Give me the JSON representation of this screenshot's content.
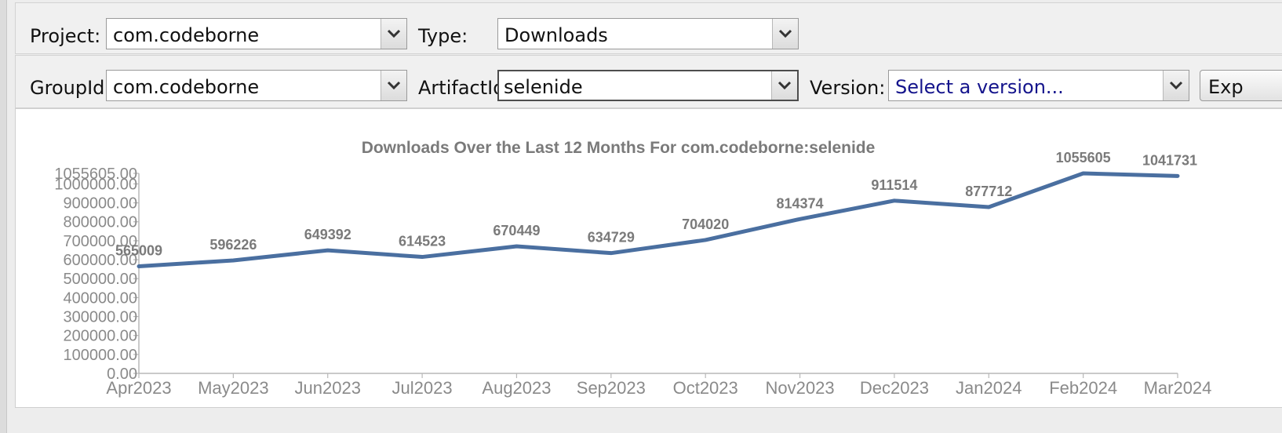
{
  "row1": {
    "project_label": "Project:",
    "project_value": "com.codeborne",
    "type_label": "Type:",
    "type_value": "Downloads"
  },
  "row2": {
    "groupid_label": "GroupId:",
    "groupid_value": "com.codeborne",
    "artifactid_label": "ArtifactId:",
    "artifactid_value": "selenide",
    "version_label": "Version:",
    "version_placeholder": "Select a version...",
    "export_button_label": "Exp"
  },
  "icons": {
    "dropdown": "chevron-down-icon"
  },
  "chart_data": {
    "type": "line",
    "title": "Downloads Over the Last 12 Months For com.codeborne:selenide",
    "categories": [
      "Apr2023",
      "May2023",
      "Jun2023",
      "Jul2023",
      "Aug2023",
      "Sep2023",
      "Oct2023",
      "Nov2023",
      "Dec2023",
      "Jan2024",
      "Feb2024",
      "Mar2024"
    ],
    "series": [
      {
        "values": [
          565009,
          596226,
          649392,
          614523,
          670449,
          634729,
          704020,
          814374,
          911514,
          877712,
          1055605,
          1041731
        ]
      }
    ],
    "data_labels": [
      "565009",
      "596226",
      "649392",
      "614523",
      "670449",
      "634729",
      "704020",
      "814374",
      "911514",
      "877712",
      "1055605",
      "1041731"
    ],
    "y_ticks": [
      "0.00",
      "100000.00",
      "200000.00",
      "300000.00",
      "400000.00",
      "500000.00",
      "600000.00",
      "700000.00",
      "800000.00",
      "900000.00",
      "1000000.00",
      "1055605.00"
    ],
    "y_tick_values": [
      0,
      100000,
      200000,
      300000,
      400000,
      500000,
      600000,
      700000,
      800000,
      900000,
      1000000,
      1055605
    ],
    "ylim": [
      0,
      1055605
    ],
    "grid": false,
    "line_color": "#4a6fa0",
    "axis_color": "#b8b8b8",
    "text_color": "#8a8a8a"
  }
}
